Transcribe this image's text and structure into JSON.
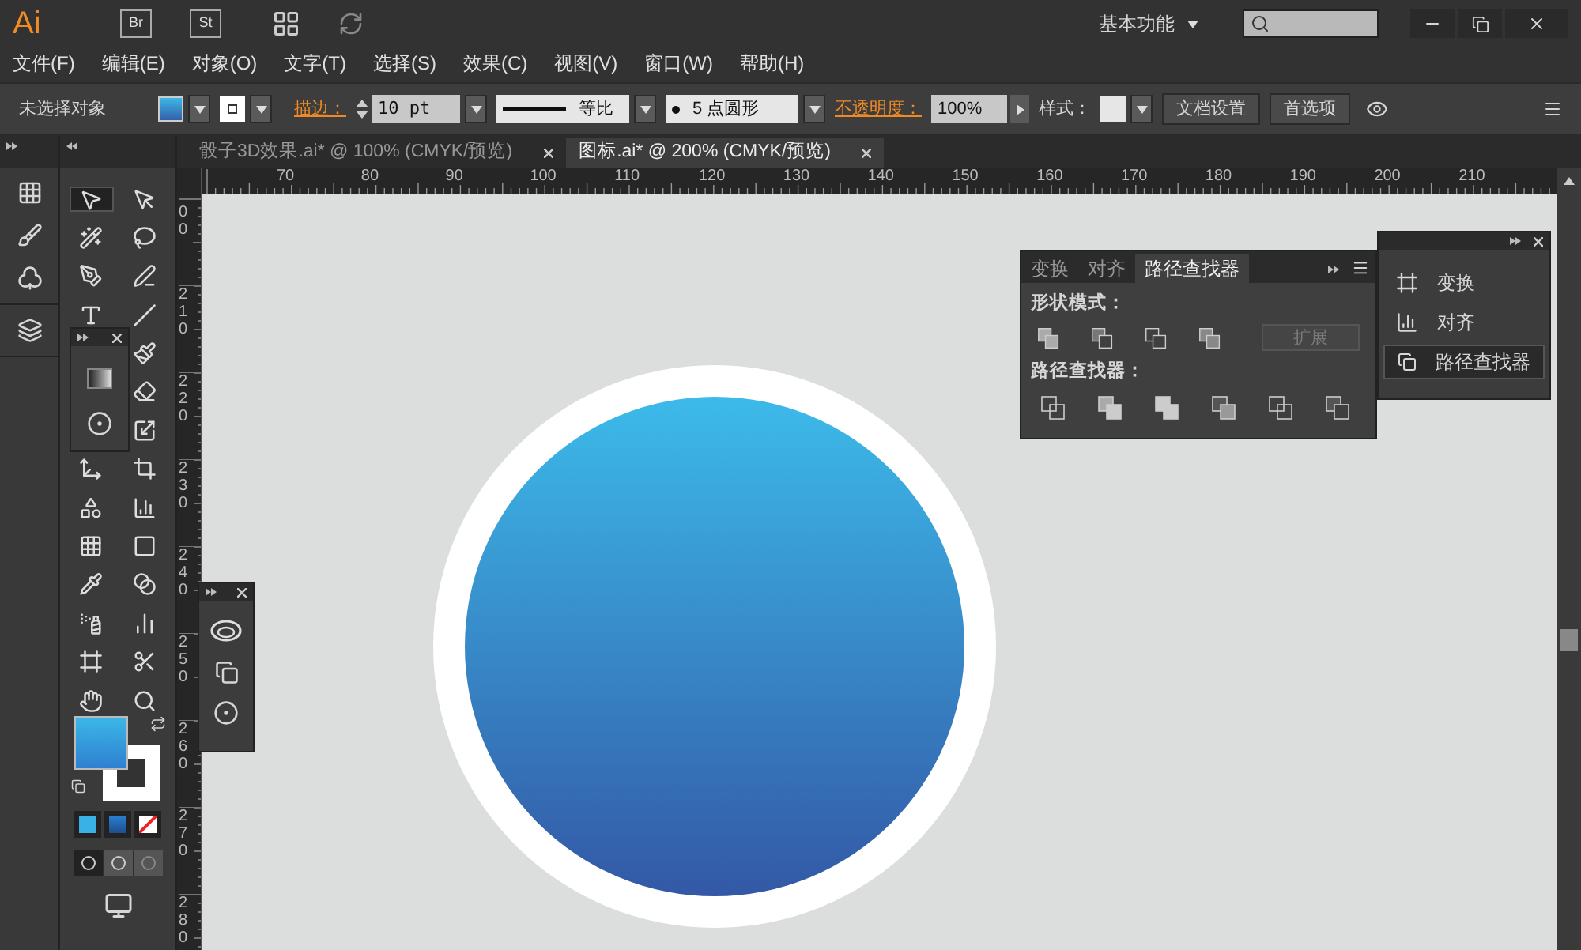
{
  "app": {
    "logo": "Ai",
    "bridge": "Br",
    "stock": "St",
    "workspace": "基本功能"
  },
  "menu": [
    "文件(F)",
    "编辑(E)",
    "对象(O)",
    "文字(T)",
    "选择(S)",
    "效果(C)",
    "视图(V)",
    "窗口(W)",
    "帮助(H)"
  ],
  "control_bar": {
    "selection": "未选择对象",
    "stroke_label": "描边：",
    "stroke_weight": "10 pt",
    "stroke_profile": "等比",
    "brush": "5 点圆形",
    "opacity_label": "不透明度：",
    "opacity": "100%",
    "style_label": "样式：",
    "buttons": [
      "文档设置",
      "首选项"
    ]
  },
  "documents": [
    {
      "title": "骰子3D效果.ai* @ 100% (CMYK/预览)",
      "selected": false
    },
    {
      "title": "图标.ai* @ 200% (CMYK/预览)",
      "selected": true
    }
  ],
  "ruler": {
    "horizontal": [
      "70",
      "80",
      "90",
      "100",
      "110",
      "120",
      "130",
      "140",
      "150",
      "160",
      "170",
      "180",
      "190",
      "200",
      "210"
    ],
    "vertical": [
      "00",
      "210",
      "220",
      "230",
      "240",
      "250",
      "260",
      "270",
      "280"
    ]
  },
  "tools": [
    {
      "selected": true
    },
    {
      "selected": false
    },
    {
      "selected": false
    },
    {
      "selected": false
    },
    {
      "selected": false
    },
    {
      "selected": false
    },
    {
      "selected": false
    },
    {
      "selected": false
    },
    {
      "selected": false
    },
    {
      "selected": false
    },
    {
      "selected": false
    },
    {
      "selected": false
    },
    {
      "selected": false
    },
    {
      "selected": false
    },
    {
      "selected": false
    },
    {
      "selected": false
    },
    {
      "selected": false
    },
    {
      "selected": false
    },
    {
      "selected": false
    },
    {
      "selected": false
    },
    {
      "selected": false
    },
    {
      "selected": false
    },
    {
      "selected": false
    },
    {
      "selected": false
    },
    {
      "selected": false
    }
  ],
  "pathfinder_panel": {
    "tabs": [
      {
        "label": "变换",
        "selected": false
      },
      {
        "label": "对齐",
        "selected": false
      },
      {
        "label": "路径查找器",
        "selected": true
      }
    ],
    "shape_modes_label": "形状模式：",
    "expand_button": {
      "label": "扩展",
      "disabled": true
    },
    "pathfinders_label": "路径查找器："
  },
  "panel_dock": {
    "items": [
      {
        "label": "变换",
        "selected": false
      },
      {
        "label": "对齐",
        "selected": false
      },
      {
        "label": "路径查找器",
        "selected": true
      }
    ]
  }
}
